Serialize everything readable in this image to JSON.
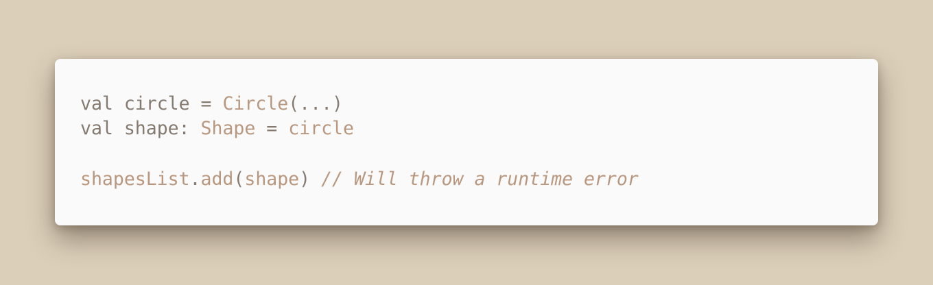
{
  "code": {
    "line1": {
      "kw": "val",
      "name": "circle",
      "op": "=",
      "ctor": "Circle",
      "args": "(...)"
    },
    "line2": {
      "kw": "val",
      "name": "shape:",
      "type": "Shape",
      "op": "=",
      "value": "circle"
    },
    "line3": {
      "receiver": "shapesList",
      "dot": ".",
      "method": "add",
      "open": "(",
      "arg": "shape",
      "close": ")",
      "comment": "// Will throw a runtime error"
    }
  },
  "colors": {
    "background": "#dccfba",
    "card": "#fafafa",
    "plain_text": "#857a6f",
    "accent_text": "#b8977e"
  }
}
